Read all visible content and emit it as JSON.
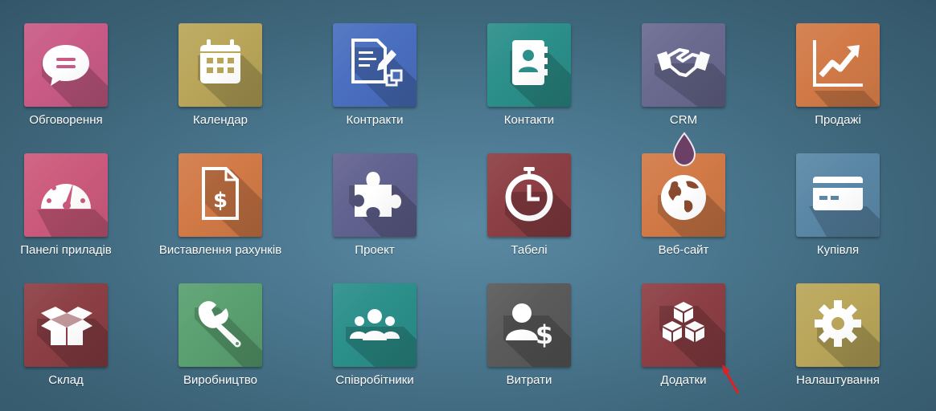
{
  "apps": [
    {
      "key": "discuss",
      "label": "Обговорення",
      "color": "#c95b86",
      "icon": "chat-bubble-icon"
    },
    {
      "key": "calendar",
      "label": "Календар",
      "color": "#b9a65a",
      "icon": "calendar-icon"
    },
    {
      "key": "contracts",
      "label": "Контракти",
      "color": "#4a6fbf",
      "icon": "document-edit-icon"
    },
    {
      "key": "contacts",
      "label": "Контакти",
      "color": "#2b8f8a",
      "icon": "address-book-icon"
    },
    {
      "key": "crm",
      "label": "CRM",
      "color": "#6a6a90",
      "icon": "handshake-icon"
    },
    {
      "key": "sales",
      "label": "Продажі",
      "color": "#d27a47",
      "icon": "chart-up-icon"
    },
    {
      "key": "dashboards",
      "label": "Панелі приладів",
      "color": "#cc5a7c",
      "icon": "gauge-icon"
    },
    {
      "key": "invoicing",
      "label": "Виставлення рахунків",
      "color": "#d27a47",
      "icon": "invoice-dollar-icon"
    },
    {
      "key": "project",
      "label": "Проект",
      "color": "#626290",
      "icon": "puzzle-icon"
    },
    {
      "key": "timesheets",
      "label": "Табелі",
      "color": "#8c3f45",
      "icon": "stopwatch-icon"
    },
    {
      "key": "website",
      "label": "Веб-сайт",
      "color": "#d27a47",
      "icon": "globe-icon"
    },
    {
      "key": "purchase",
      "label": "Купівля",
      "color": "#5a87a6",
      "icon": "credit-card-icon"
    },
    {
      "key": "inventory",
      "label": "Склад",
      "color": "#8c3f45",
      "icon": "open-box-icon"
    },
    {
      "key": "manufacturing",
      "label": "Виробництво",
      "color": "#5aa070",
      "icon": "wrench-icon"
    },
    {
      "key": "employees",
      "label": "Співробітники",
      "color": "#2b8f8a",
      "icon": "team-icon"
    },
    {
      "key": "expenses",
      "label": "Витрати",
      "color": "#5a5a5a",
      "icon": "person-dollar-icon"
    },
    {
      "key": "apps",
      "label": "Додатки",
      "color": "#8c3f45",
      "icon": "cubes-icon"
    },
    {
      "key": "settings",
      "label": "Налаштування",
      "color": "#b9a65a",
      "icon": "gear-icon"
    }
  ],
  "accent_drop_color": "#6b3f66",
  "annotation_arrow_color": "#e02020"
}
